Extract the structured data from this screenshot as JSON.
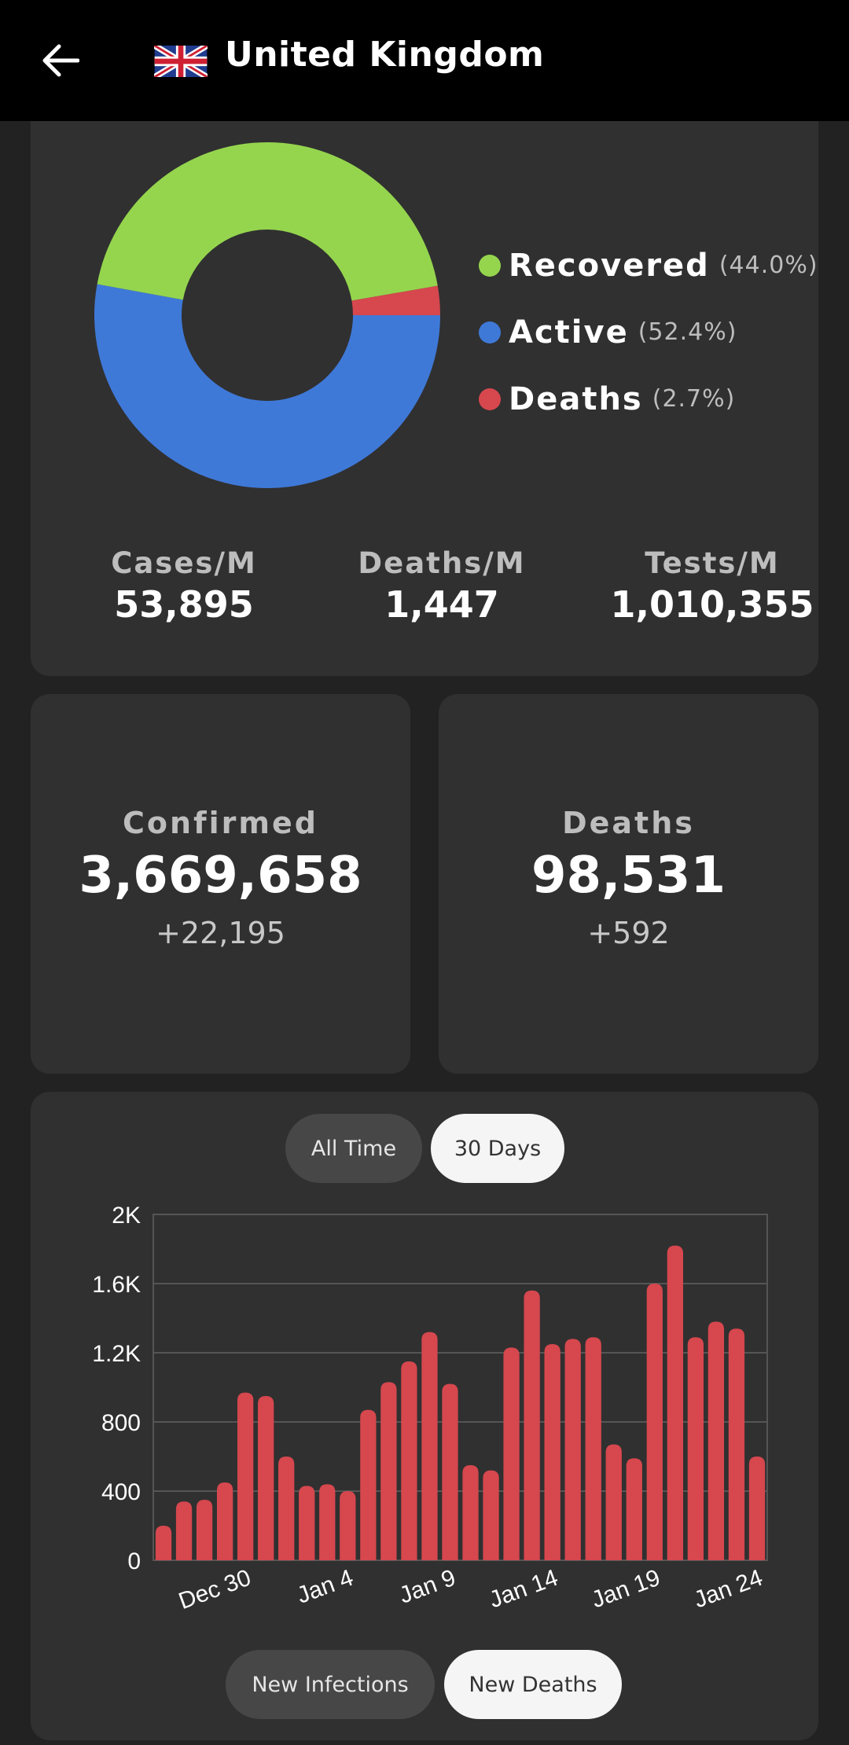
{
  "header": {
    "title": "United Kingdom",
    "flag_icon": "uk-flag-icon",
    "back_icon": "arrow-left-icon"
  },
  "colors": {
    "background": "#222222",
    "card": "#303030",
    "recovered": "#95d54e",
    "active": "#3f79d8",
    "deaths": "#d6474e",
    "topbar": "#000000"
  },
  "breakdown": {
    "legend": [
      {
        "label": "Recovered",
        "pct": "(44.0%)",
        "value": 44.0,
        "color": "#95d54e"
      },
      {
        "label": "Active",
        "pct": "(52.4%)",
        "value": 52.4,
        "color": "#3f79d8"
      },
      {
        "label": "Deaths",
        "pct": "(2.7%)",
        "value": 2.7,
        "color": "#d6474e"
      }
    ]
  },
  "per_million": {
    "cases_label": "Cases/M",
    "cases_value": "53,895",
    "deaths_label": "Deaths/M",
    "deaths_value": "1,447",
    "tests_label": "Tests/M",
    "tests_value": "1,010,355"
  },
  "confirmed": {
    "label": "Confirmed",
    "value": "3,669,658",
    "delta": "+22,195"
  },
  "deaths": {
    "label": "Deaths",
    "value": "98,531",
    "delta": "+592"
  },
  "range_toggle": {
    "all_time": "All Time",
    "thirty_days": "30 Days",
    "selected": "30 Days"
  },
  "metric_toggle": {
    "infections": "New Infections",
    "deaths": "New Deaths",
    "selected": "New Deaths"
  },
  "chart_data": {
    "type": "bar",
    "series": [
      {
        "values": [
          200,
          340,
          350,
          450,
          970,
          950,
          600,
          430,
          440,
          400,
          870,
          1030,
          1150,
          1320,
          1020,
          550,
          520,
          1230,
          1560,
          1250,
          1280,
          1290,
          670,
          590,
          1600,
          1820,
          1290,
          1380,
          1340,
          600
        ]
      }
    ],
    "x_tick_labels": [
      "Dec 30",
      "Jan 4",
      "Jan 9",
      "Jan 14",
      "Jan 19",
      "Jan 24"
    ],
    "x_tick_bar_index": [
      5,
      10,
      15,
      20,
      25,
      30
    ],
    "y_tick_labels": [
      "0",
      "400",
      "800",
      "1.2K",
      "1.6K",
      "2K"
    ],
    "ylim": [
      0,
      2000
    ],
    "grid": true,
    "bar_color": "#d6474e"
  }
}
